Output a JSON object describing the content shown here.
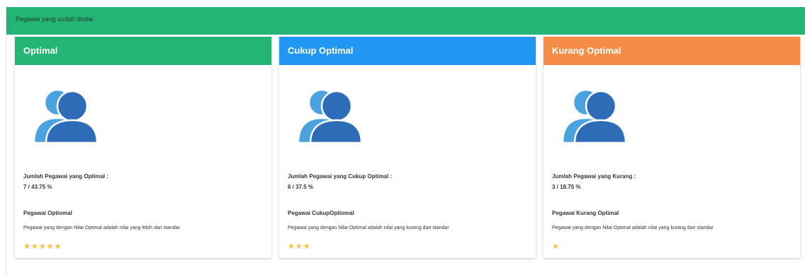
{
  "panel": {
    "title": "Pegawai yang sudah dinilai",
    "color": "#22b573"
  },
  "cards": [
    {
      "title": "Optimal",
      "header_color": "#22b573",
      "icon": "users-icon",
      "count_label": "Jumlah Pegawai yang Optimal :",
      "count_value": "7 / 43.75 %",
      "desc_title": "Pegawai Optiomal",
      "desc_text": "Pegawai yang dengan Nilai Optimal adalah nilai yang lebih dari standar",
      "stars": "★★★★★",
      "rating": 5
    },
    {
      "title": "Cukup Optimal",
      "header_color": "#2196f3",
      "icon": "users-icon",
      "count_label": "Jumlah Pegawai yang Cukup Optimal :",
      "count_value": "6 / 37.5 %",
      "desc_title": "Pegawai CukupOptiomal",
      "desc_text": "Pegawai yang dengan Nilai Optimal adalah nilai yang kurang dari standar",
      "stars": "★★★",
      "rating": 3
    },
    {
      "title": "Kurang Optimal",
      "header_color": "#f68c45",
      "icon": "users-icon",
      "count_label": "Jumlah Pegawai yang Kurang :",
      "count_value": "3 / 18.75 %",
      "desc_title": "Pegawai Kurang Optimal",
      "desc_text": "Pegawai yang dengan Nilai Optimal adalah nilai yang kurang dari standar",
      "stars": "★",
      "rating": 1
    }
  ],
  "colors": {
    "star": "#f7c137",
    "icon_back": "#4aa3df",
    "icon_front": "#2d6db8"
  }
}
